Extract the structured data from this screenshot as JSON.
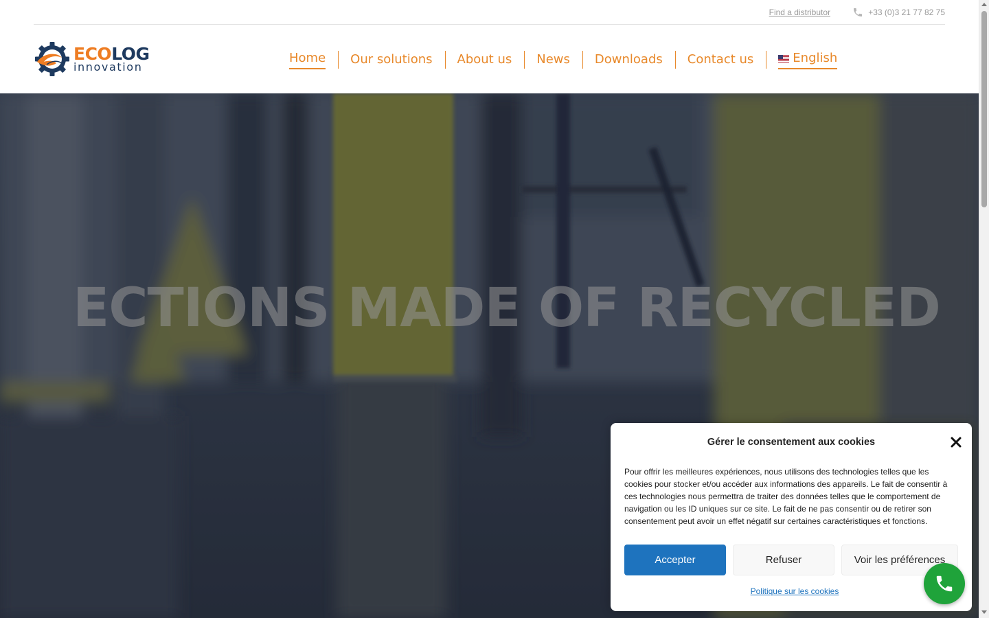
{
  "topbar": {
    "distributor_link": "Find a distributor",
    "phone": "+33 (0)3 21 77 82 75",
    "phone_icon": "phone-icon"
  },
  "logo": {
    "eco": "ECO",
    "log": "LOG",
    "sub": "innovation",
    "colors": {
      "orange": "#ee7d23",
      "navy": "#1e3a5f"
    }
  },
  "nav": {
    "items": [
      {
        "label": "Home",
        "active": true
      },
      {
        "label": "Our solutions"
      },
      {
        "label": "About us"
      },
      {
        "label": "News"
      },
      {
        "label": "Downloads"
      },
      {
        "label": "Contact us"
      }
    ],
    "language": "English",
    "accent": "#e8892b"
  },
  "hero": {
    "headline": "ECTIONS MADE OF RECYCLED"
  },
  "cookie": {
    "title": "Gérer le consentement aux cookies",
    "text": "Pour offrir les meilleures expériences, nous utilisons des technologies telles que les cookies pour stocker et/ou accéder aux informations des appareils. Le fait de consentir à ces technologies nous permettra de traiter des données telles que le comportement de navigation ou les ID uniques sur ce site. Le fait de ne pas consentir ou de retirer son consentement peut avoir un effet négatif sur certaines caractéristiques et fonctions.",
    "accept": "Accepter",
    "refuse": "Refuser",
    "preferences": "Voir les préférences",
    "policy": "Politique sur les cookies",
    "accept_color": "#1e73be"
  },
  "fab": {
    "icon": "phone-icon",
    "color": "#1fa33a"
  }
}
